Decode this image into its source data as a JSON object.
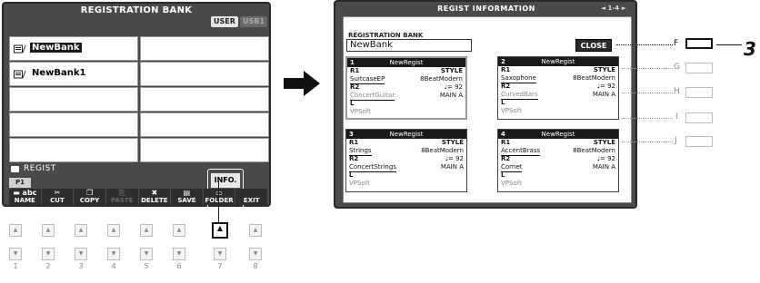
{
  "left_screen": {
    "title": "REGISTRATION BANK",
    "tabs": [
      "USER",
      "USB1"
    ],
    "banks": [
      "NewBank",
      "",
      "NewBank1",
      "",
      "",
      "",
      "",
      "",
      "",
      ""
    ],
    "path": "REGIST",
    "page": "P1",
    "info_label": "INFO.",
    "functions": [
      {
        "icon": "▬ abc",
        "label": "NAME"
      },
      {
        "icon": "✂",
        "label": "CUT"
      },
      {
        "icon": "❐",
        "label": "COPY"
      },
      {
        "icon": "⎘",
        "label": "PASTE"
      },
      {
        "icon": "✖",
        "label": "DELETE"
      },
      {
        "icon": "▤",
        "label": "SAVE"
      },
      {
        "icon": "▭",
        "label": "FOLDER"
      },
      {
        "icon": "",
        "label": "EXIT"
      }
    ]
  },
  "buttons": {
    "numbers": [
      "1",
      "2",
      "3",
      "4",
      "5",
      "6",
      "7",
      "8"
    ],
    "highlight_index": 7
  },
  "right_screen": {
    "title": "REGIST INFORMATION",
    "page_indicator": "◄ 1-4 ►",
    "bank_label": "REGISTRATION BANK",
    "bank_name": "NewBank",
    "close_label": "CLOSE",
    "regists": [
      {
        "num": "1",
        "name": "NewRegist",
        "r1": "R1",
        "style_lbl": "STYLE",
        "r1_voice": "SuitcaseEP",
        "style": "8BeatModern",
        "tempo": "♩= 92",
        "r2": "R2",
        "r2_voice": "ConcertGuitar",
        "section": "MAIN A",
        "l": "L",
        "l_voice": "VPSoft"
      },
      {
        "num": "2",
        "name": "NewRegist",
        "r1": "R1",
        "style_lbl": "STYLE",
        "r1_voice": "Saxophone",
        "style": "8BeatModern",
        "tempo": "♩= 92",
        "r2": "R2",
        "r2_voice": "CurvedBars",
        "section": "MAIN A",
        "l": "L",
        "l_voice": "VPSoft"
      },
      {
        "num": "3",
        "name": "NewRegist",
        "r1": "R1",
        "style_lbl": "STYLE",
        "r1_voice": "Strings",
        "style": "8BeatModern",
        "tempo": "♩= 92",
        "r2": "R2",
        "r2_voice": "ConcertStrings",
        "section": "MAIN A",
        "l": "L",
        "l_voice": "VPSoft"
      },
      {
        "num": "4",
        "name": "NewRegist",
        "r1": "R1",
        "style_lbl": "STYLE",
        "r1_voice": "AccentBrass",
        "style": "8BeatModern",
        "tempo": "♩= 92",
        "r2": "R2",
        "r2_voice": "Cornet",
        "section": "MAIN A",
        "l": "L",
        "l_voice": "VPSoft"
      }
    ]
  },
  "side_labels": [
    "F",
    "G",
    "H",
    "I",
    "J"
  ],
  "step": "3"
}
